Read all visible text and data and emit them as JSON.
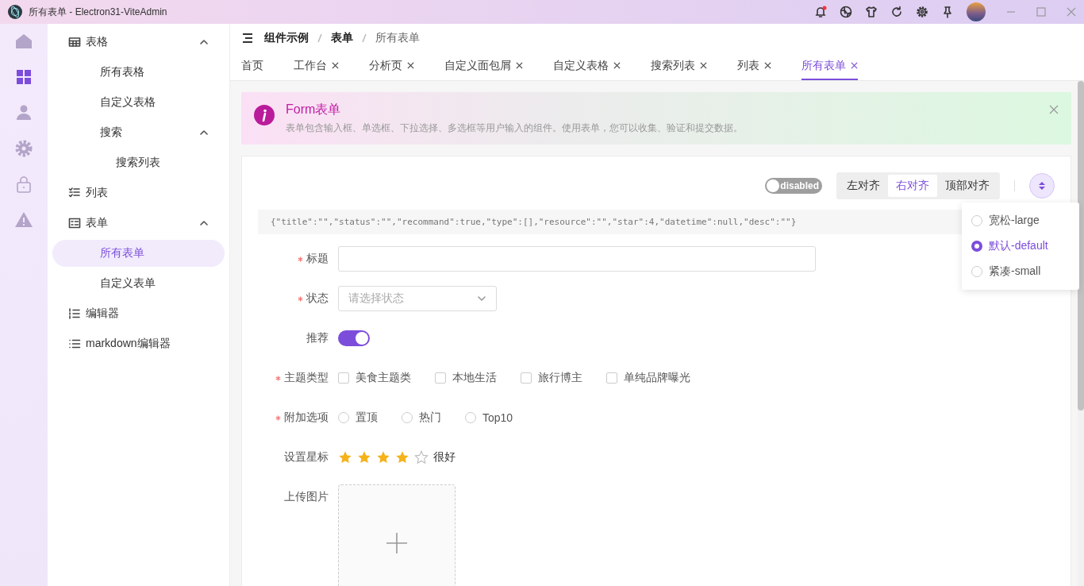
{
  "window": {
    "title": "所有表单 - Electron31-ViteAdmin"
  },
  "icon_rail": [
    {
      "kind": "home",
      "selected": false
    },
    {
      "kind": "grid",
      "selected": true
    },
    {
      "kind": "user",
      "selected": false
    },
    {
      "kind": "gear",
      "selected": false
    },
    {
      "kind": "lock",
      "selected": false
    },
    {
      "kind": "warning",
      "selected": false
    }
  ],
  "sidebar": {
    "items": [
      {
        "label": "表格",
        "kind": "table",
        "selected": false,
        "expanded": true,
        "children": [
          {
            "label": "所有表格",
            "selected": false
          },
          {
            "label": "自定义表格",
            "selected": false
          },
          {
            "label": "搜索",
            "selected": false,
            "expanded": true,
            "children": [
              {
                "label": "搜索列表",
                "selected": false
              }
            ]
          }
        ]
      },
      {
        "label": "列表",
        "kind": "checklist",
        "selected": false
      },
      {
        "label": "表单",
        "kind": "form",
        "selected": false,
        "expanded": true,
        "children": [
          {
            "label": "所有表单",
            "selected": true
          },
          {
            "label": "自定义表单",
            "selected": false
          }
        ]
      },
      {
        "label": "编辑器",
        "kind": "numbered",
        "selected": false
      },
      {
        "label": "markdown编辑器",
        "kind": "list",
        "selected": false
      }
    ]
  },
  "breadcrumb": [
    "组件示例",
    "表单",
    "所有表单"
  ],
  "tabs": [
    {
      "label": "首页",
      "selected": false,
      "closable": false
    },
    {
      "label": "工作台",
      "selected": false,
      "closable": true
    },
    {
      "label": "分析页",
      "selected": false,
      "closable": true
    },
    {
      "label": "自定义面包屑",
      "selected": false,
      "closable": true
    },
    {
      "label": "自定义表格",
      "selected": false,
      "closable": true
    },
    {
      "label": "搜索列表",
      "selected": false,
      "closable": true
    },
    {
      "label": "列表",
      "selected": false,
      "closable": true
    },
    {
      "label": "所有表单",
      "selected": true,
      "closable": true
    }
  ],
  "alert": {
    "title": "Form表单",
    "description": "表单包含输入框、单选框、下拉选择、多选框等用户输入的组件。使用表单，您可以收集、验证和提交数据。"
  },
  "toolbar": {
    "disable_switch": {
      "label": "disabled",
      "on": false
    },
    "align": [
      {
        "label": "左对齐",
        "selected": false
      },
      {
        "label": "右对齐",
        "selected": true
      },
      {
        "label": "顶部对齐",
        "selected": false
      }
    ],
    "size_menu": [
      {
        "label": "宽松-large",
        "selected": false
      },
      {
        "label": "默认-default",
        "selected": true
      },
      {
        "label": "紧凑-small",
        "selected": false
      }
    ]
  },
  "json_preview": "{\"title\":\"\",\"status\":\"\",\"recommand\":true,\"type\":[],\"resource\":\"\",\"star\":4,\"datetime\":null,\"desc\":\"\"}",
  "form": [
    {
      "kind": "input",
      "label": "标题",
      "required": true
    },
    {
      "kind": "select",
      "label": "状态",
      "required": true,
      "placeholder": "请选择状态"
    },
    {
      "kind": "switch",
      "label": "推荐",
      "required": false,
      "on": true
    },
    {
      "kind": "checkbox",
      "label": "主题类型",
      "required": true,
      "options": [
        {
          "label": "美食主题类",
          "checked": false
        },
        {
          "label": "本地生活",
          "checked": false
        },
        {
          "label": "旅行博主",
          "checked": false
        },
        {
          "label": "单纯品牌曝光",
          "checked": false
        }
      ]
    },
    {
      "kind": "radio",
      "label": "附加选项",
      "required": true,
      "options": [
        {
          "label": "置顶",
          "selected": false
        },
        {
          "label": "热门",
          "selected": false
        },
        {
          "label": "Top10",
          "selected": false
        }
      ]
    },
    {
      "kind": "rate",
      "label": "设置星标",
      "required": false,
      "stars": 4,
      "text": "很好"
    },
    {
      "kind": "upload",
      "label": "上传图片",
      "required": false
    }
  ]
}
